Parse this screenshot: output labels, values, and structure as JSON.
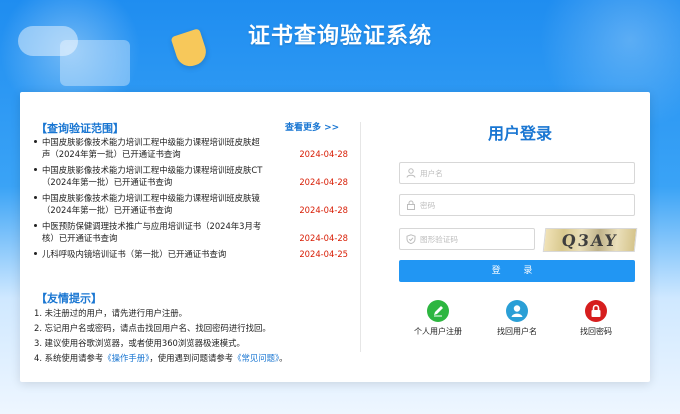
{
  "header": {
    "title": "证书查询验证系统"
  },
  "query_scope": {
    "title": "【查询验证范围】",
    "more_label": "查看更多 >>",
    "items": [
      {
        "text": "中国皮肤影像技术能力培训工程中级能力课程培训班皮肤超声（2024年第一批）已开通证书查询",
        "date": "2024-04-28"
      },
      {
        "text": "中国皮肤影像技术能力培训工程中级能力课程培训班皮肤CT（2024年第一批）已开通证书查询",
        "date": "2024-04-28"
      },
      {
        "text": "中国皮肤影像技术能力培训工程中级能力课程培训班皮肤镜（2024年第一批）已开通证书查询",
        "date": "2024-04-28"
      },
      {
        "text": "中医预防保健调理技术推广与应用培训证书（2024年3月考核）已开通证书查询",
        "date": "2024-04-28"
      },
      {
        "text": "儿科呼吸内镜培训证书（第一批）已开通证书查询",
        "date": "2024-04-25"
      }
    ]
  },
  "tips": {
    "title": "【友情提示】",
    "items": [
      {
        "text": "1. 未注册过的用户，请先进行用户注册。"
      },
      {
        "text": "2. 忘记用户名或密码，请点击找回用户名、找回密码进行找回。"
      },
      {
        "text": "3. 建议使用谷歌浏览器，或者使用360浏览器极速模式。"
      },
      {
        "pre": "4. 系统使用请参考",
        "link1": "《操作手册》",
        "mid": "，使用遇到问题请参考",
        "link2": "《常见问题》",
        "post": "。"
      }
    ]
  },
  "login": {
    "title": "用户登录",
    "username_placeholder": "用户名",
    "password_placeholder": "密码",
    "captcha_placeholder": "图形验证码",
    "captcha_text": "Q3AY",
    "submit_label": "登 录"
  },
  "quick_links": [
    {
      "label": "个人用户注册",
      "icon": "pencil-icon",
      "color": "#2db640"
    },
    {
      "label": "找回用户名",
      "icon": "user-icon",
      "color": "#2a9fd6"
    },
    {
      "label": "找回密码",
      "icon": "lock-icon",
      "color": "#d61e1e"
    }
  ],
  "colors": {
    "accent": "#1976d2",
    "date_red": "#d81e06",
    "button_blue": "#2196f3"
  }
}
